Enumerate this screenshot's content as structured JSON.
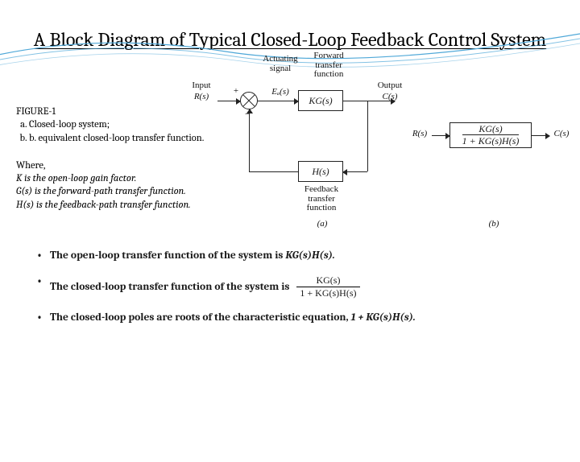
{
  "title": "A Block Diagram of Typical Closed-Loop Feedback Control System",
  "figure": {
    "label": "FIGURE-1",
    "item_a": "Closed-loop system;",
    "item_b": "b. equivalent closed-loop transfer function."
  },
  "where": {
    "heading": "Where,",
    "line1": "K is the open-loop gain factor.",
    "line2": "G(s) is the forward-path transfer function.",
    "line3": "H(s) is the feedback-path transfer function."
  },
  "diagram": {
    "input": "Input",
    "rs": "R(s)",
    "actuating": "Actuating signal",
    "ea": "Eₐ(s)",
    "forward": "Forward transfer function",
    "kg": "KG(s)",
    "output": "Output",
    "cs": "C(s)",
    "plus": "+",
    "minus": "−",
    "hs": "H(s)",
    "feedback": "Feedback transfer function",
    "fig_a": "(a)",
    "fig_b": "(b)",
    "frac_num": "KG(s)",
    "frac_den": "1 + KG(s)H(s)"
  },
  "bullets": {
    "b1a": "The open-loop transfer function of the system is  ",
    "b1b": "KG(s)H(s).",
    "b2": "The closed-loop transfer function of the system is",
    "b2_num": "KG(s)",
    "b2_den": "1 + KG(s)H(s)",
    "b3a": "The closed-loop poles are roots of the characteristic equation,  ",
    "b3b": "1 + KG(s)H(s)."
  }
}
